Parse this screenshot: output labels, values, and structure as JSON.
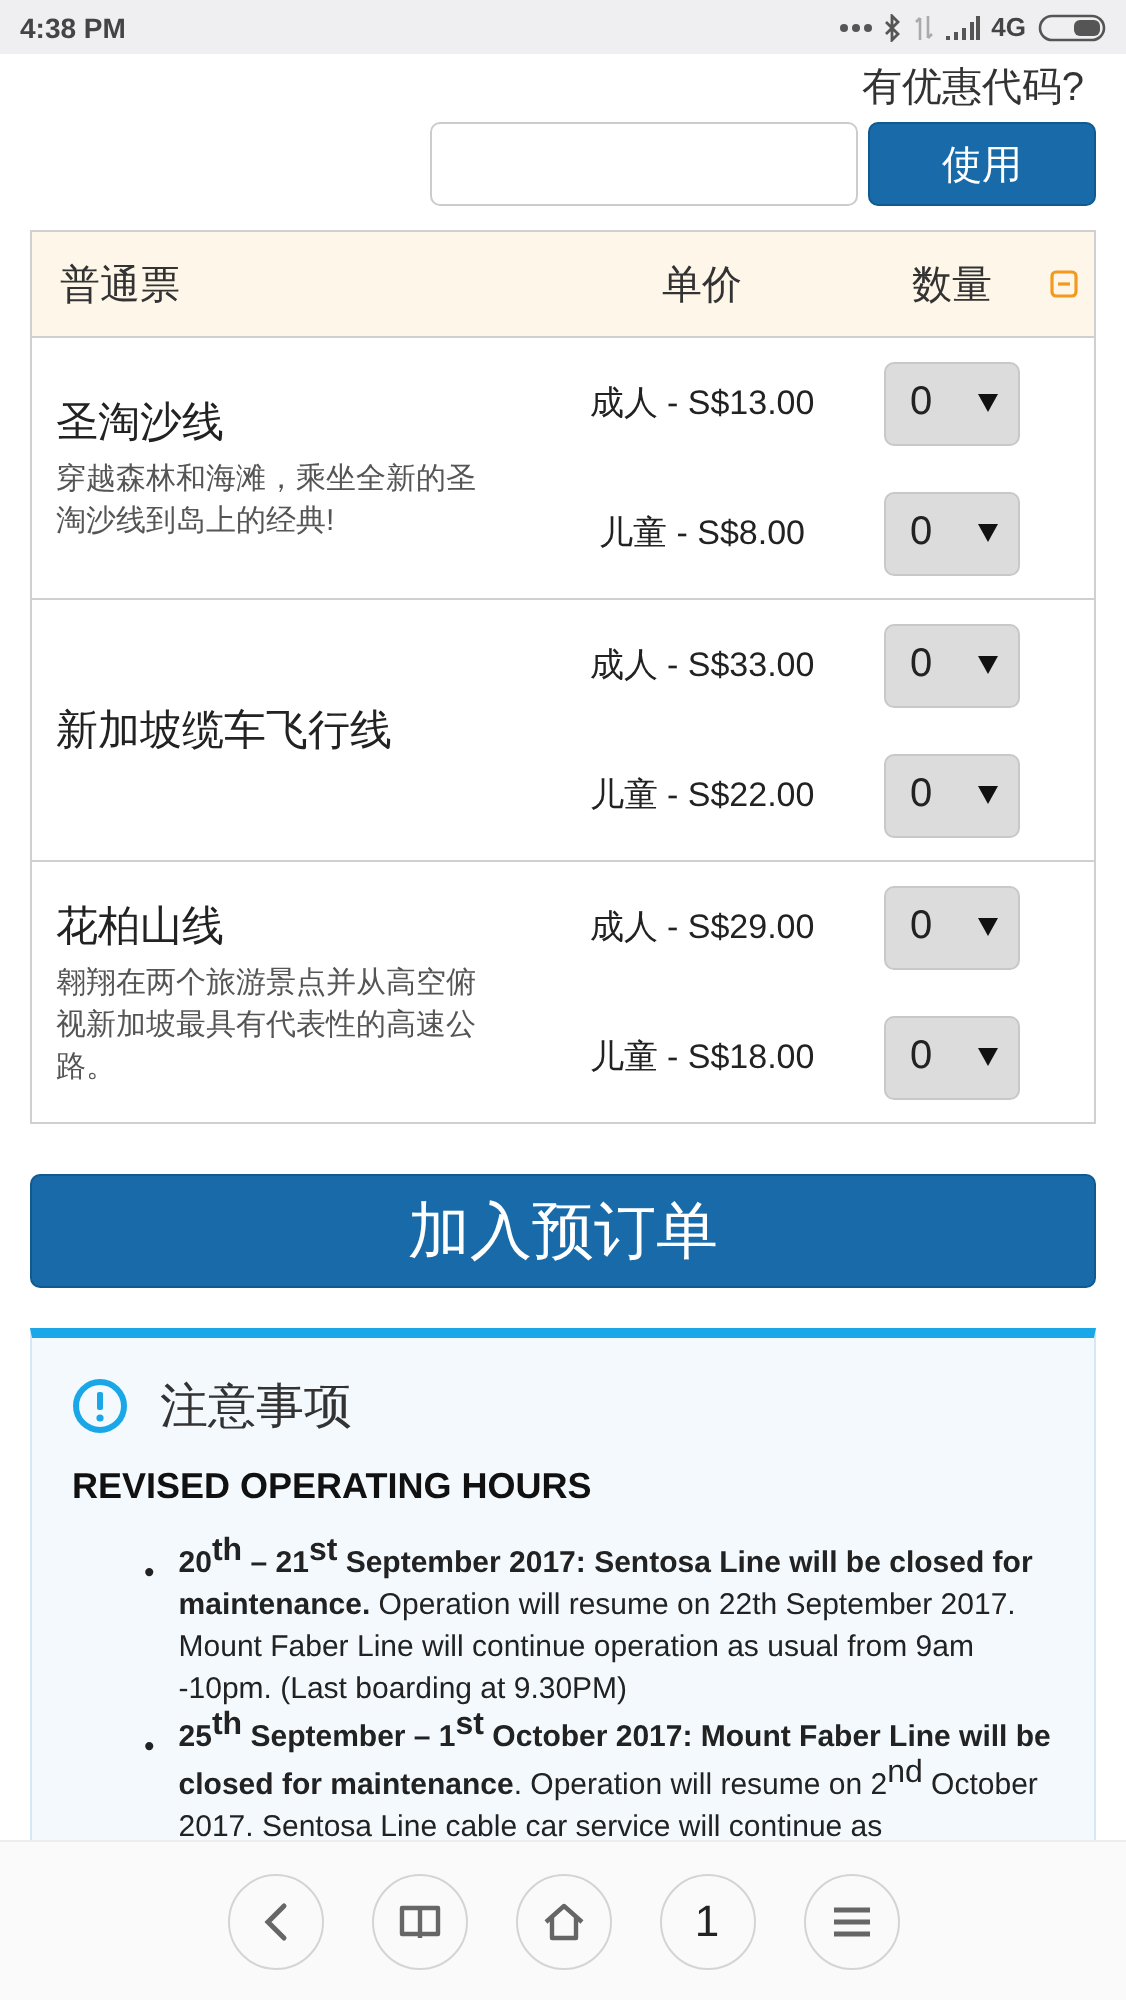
{
  "status_bar": {
    "time": "4:38 PM",
    "network": "4G"
  },
  "promo": {
    "label": "有优惠代码?",
    "button": "使用"
  },
  "table": {
    "columns": [
      "普通票",
      "单价",
      "数量"
    ],
    "rows": [
      {
        "name": "圣淘沙线",
        "description": "穿越森林和海滩，乘坐全新的圣淘沙线到岛上的经典!",
        "prices": [
          {
            "label": "成人 - S$13.00",
            "qty": "0"
          },
          {
            "label": "儿童 - S$8.00",
            "qty": "0"
          }
        ]
      },
      {
        "name": "新加坡缆车飞行线",
        "prices": [
          {
            "label": "成人 - S$33.00",
            "qty": "0"
          },
          {
            "label": "儿童 - S$22.00",
            "qty": "0"
          }
        ]
      },
      {
        "name": "花柏山线",
        "description": "翱翔在两个旅游景点并从高空俯视新加坡最具有代表性的高速公路。",
        "prices": [
          {
            "label": "成人 - S$29.00",
            "qty": "0"
          },
          {
            "label": "儿童 - S$18.00",
            "qty": "0"
          }
        ]
      }
    ]
  },
  "add_button": "加入预订单",
  "notice": {
    "title": "注意事项",
    "heading": "REVISED OPERATING HOURS",
    "items": [
      {
        "bullet": "•",
        "text": "**20$^{th}$ – 21$^{st}$ September 2017: Sentosa Line will be closed for maintenance.** Operation will resume on 22th September 2017. Mount Faber Line will continue operation as usual from 9am -10pm. (Last boarding at 9.30PM)"
      },
      {
        "bullet": "•",
        "text": "**25$^{th}$ September – 1$^{st}$ October 2017: Mount Faber Line will be closed for maintenance**. Operation will resume on 2$^{nd}$ October 2017. Sentosa Line cable car service will continue as"
      }
    ]
  },
  "bottom_nav": {
    "tab_count": "1"
  }
}
